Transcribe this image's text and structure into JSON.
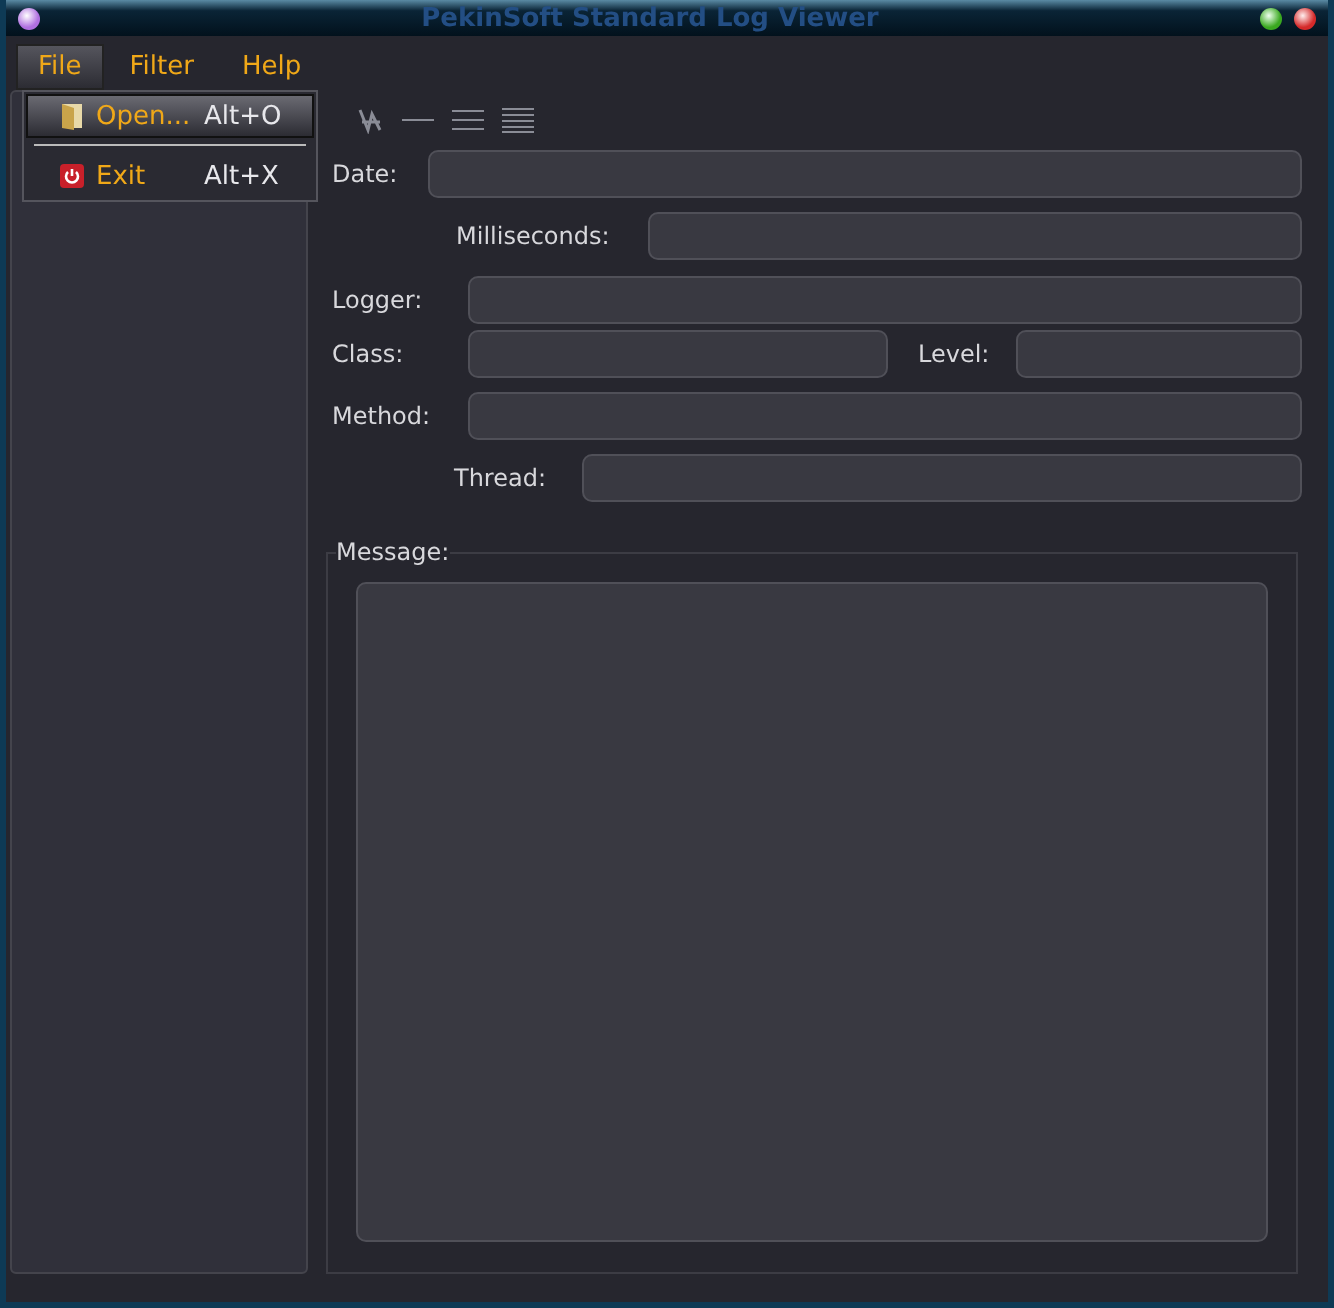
{
  "window": {
    "title": "PekinSoft Standard Log Viewer"
  },
  "menubar": [
    {
      "label": "File",
      "selected": true
    },
    {
      "label": "Filter",
      "selected": false
    },
    {
      "label": "Help",
      "selected": false
    }
  ],
  "file_menu": [
    {
      "kind": "item",
      "label": "Open...",
      "shortcut": "Alt+O",
      "selected": true
    },
    {
      "kind": "separator"
    },
    {
      "kind": "item",
      "label": "Exit",
      "shortcut": "Alt+X",
      "selected": false
    }
  ],
  "fields": {
    "date": "Date:",
    "milliseconds": "Milliseconds:",
    "logger": "Logger:",
    "class": "Class:",
    "level": "Level:",
    "method": "Method:",
    "thread": "Thread:"
  },
  "message": {
    "label": "Message:"
  }
}
